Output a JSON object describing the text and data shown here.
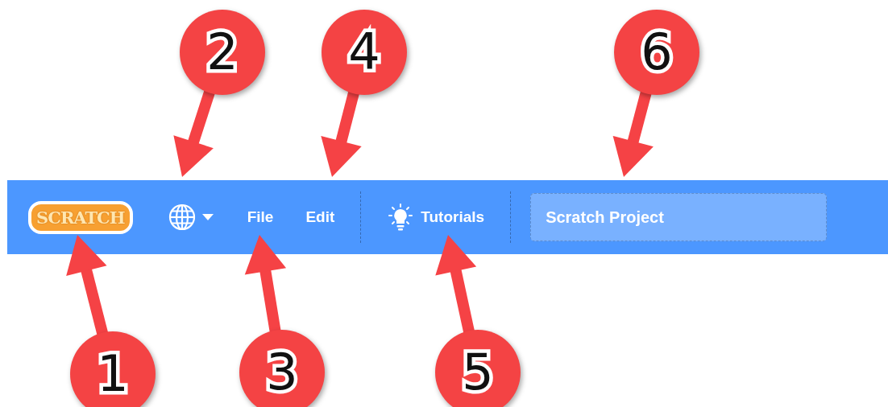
{
  "menu_bar": {
    "logo": "SCRATCH",
    "menus": [
      {
        "kind": "language"
      },
      {
        "kind": "text",
        "label": "File"
      },
      {
        "kind": "text",
        "label": "Edit"
      },
      {
        "kind": "divider"
      },
      {
        "kind": "tutorials",
        "label": "Tutorials"
      },
      {
        "kind": "divider"
      }
    ],
    "project_title": {
      "value": "Scratch Project"
    }
  },
  "callouts": [
    "1",
    "2",
    "3",
    "4",
    "5",
    "6"
  ]
}
